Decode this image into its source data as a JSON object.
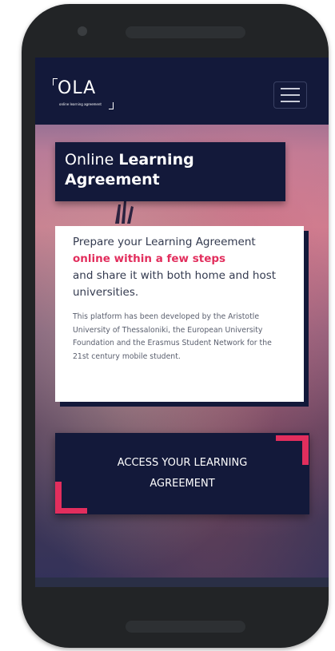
{
  "logo": {
    "text": "OLA",
    "subtitle": "online learning agreement"
  },
  "menu": {
    "icon": "hamburger-menu-icon"
  },
  "hero": {
    "title_light": "Online",
    "title_bold_1": "Learning",
    "title_bold_2": "Agreement"
  },
  "info": {
    "lead_1": "Prepare your Learning Agreement",
    "lead_accent": "online within a few steps",
    "lead_2": "and share it with both home and host universities.",
    "description": "This platform has been developed by the Aristotle University of Thessaloniki, the European University Foundation and the Erasmus Student Network for the 21st century mobile student."
  },
  "cta": {
    "label": "ACCESS YOUR LEARNING AGREEMENT"
  },
  "colors": {
    "navy": "#13193a",
    "accent": "#e22e5d",
    "white": "#ffffff"
  }
}
